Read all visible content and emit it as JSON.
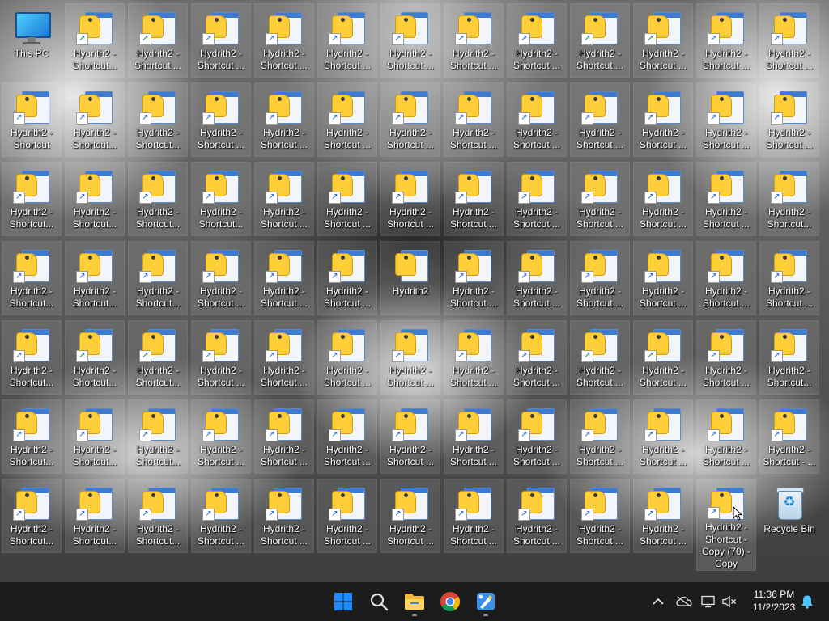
{
  "desktop": {
    "this_pc_label": "This PC",
    "recycle_bin_label": "Recycle Bin",
    "copy_label": "Hydrith2 - Shortcut - Copy (70) - Copy",
    "rows": [
      [
        "Hydrith2 - Shortcut...",
        "Hydrith2 - Shortcut ...",
        "Hydrith2 - Shortcut ...",
        "Hydrith2 - Shortcut ...",
        "Hydrith2 - Shortcut ...",
        "Hydrith2 - Shortcut ...",
        "Hydrith2 - Shortcut ...",
        "Hydrith2 - Shortcut ...",
        "Hydrith2 - Shortcut ...",
        "Hydrith2 - Shortcut ...",
        "Hydrith2 - Shortcut ...",
        "Hydrith2 - Shortcut ..."
      ],
      [
        "Hydrith2 - Shortcut",
        "Hydrith2 - Shortcut...",
        "Hydrith2 - Shortcut...",
        "Hydrith2 - Shortcut ...",
        "Hydrith2 - Shortcut ...",
        "Hydrith2 - Shortcut ...",
        "Hydrith2 - Shortcut ...",
        "Hydrith2 - Shortcut ...",
        "Hydrith2 - Shortcut ...",
        "Hydrith2 - Shortcut ...",
        "Hydrith2 - Shortcut ...",
        "Hydrith2 - Shortcut ...",
        "Hydrith2 - Shortcut ..."
      ],
      [
        "Hydrith2 - Shortcut...",
        "Hydrith2 - Shortcut...",
        "Hydrith2 - Shortcut...",
        "Hydrith2 - Shortcut...",
        "Hydrith2 - Shortcut ...",
        "Hydrith2 - Shortcut ...",
        "Hydrith2 - Shortcut ...",
        "Hydrith2 - Shortcut ...",
        "Hydrith2 - Shortcut ...",
        "Hydrith2 - Shortcut ...",
        "Hydrith2 - Shortcut ...",
        "Hydrith2 - Shortcut ...",
        "Hydrith2 - Shortcut..."
      ],
      [
        "Hydrith2 - Shortcut...",
        "Hydrith2 - Shortcut...",
        "Hydrith2 - Shortcut...",
        "Hydrith2 - Shortcut ...",
        "Hydrith2 - Shortcut ...",
        "Hydrith2 - Shortcut ...",
        "Hydrith2",
        "Hydrith2 - Shortcut ...",
        "Hydrith2 - Shortcut ...",
        "Hydrith2 - Shortcut ...",
        "Hydrith2 - Shortcut ...",
        "Hydrith2 - Shortcut ...",
        "Hydrith2 - Shortcut ..."
      ],
      [
        "Hydrith2 - Shortcut...",
        "Hydrith2 - Shortcut...",
        "Hydrith2 - Shortcut...",
        "Hydrith2 - Shortcut ...",
        "Hydrith2 - Shortcut ...",
        "Hydrith2 - Shortcut ...",
        "Hydrith2 - Shortcut ...",
        "Hydrith2 - Shortcut ...",
        "Hydrith2 - Shortcut ...",
        "Hydrith2 - Shortcut ...",
        "Hydrith2 - Shortcut ...",
        "Hydrith2 - Shortcut ...",
        "Hydrith2 - Shortcut..."
      ],
      [
        "Hydrith2 - Shortcut...",
        "Hydrith2 - Shortcut...",
        "Hydrith2 - Shortcut...",
        "Hydrith2 - Shortcut ...",
        "Hydrith2 - Shortcut ...",
        "Hydrith2 - Shortcut ...",
        "Hydrith2 - Shortcut ...",
        "Hydrith2 - Shortcut ...",
        "Hydrith2 - Shortcut ...",
        "Hydrith2 - Shortcut ...",
        "Hydrith2 - Shortcut ...",
        "Hydrith2 - Shortcut ...",
        "Hydrith2 - Shortcut - ..."
      ],
      [
        "Hydrith2 - Shortcut...",
        "Hydrith2 - Shortcut...",
        "Hydrith2 - Shortcut...",
        "Hydrith2 - Shortcut ...",
        "Hydrith2 - Shortcut ...",
        "Hydrith2 - Shortcut ...",
        "Hydrith2 - Shortcut ...",
        "Hydrith2 - Shortcut ...",
        "Hydrith2 - Shortcut ...",
        "Hydrith2 - Shortcut ...",
        "Hydrith2 - Shortcut ..."
      ]
    ]
  },
  "taskbar": {
    "apps": [
      {
        "name": "start-button",
        "icon": "windows-logo-icon"
      },
      {
        "name": "search-button",
        "icon": "search-icon"
      },
      {
        "name": "file-explorer-button",
        "icon": "folder-icon"
      },
      {
        "name": "chrome-button",
        "icon": "chrome-icon"
      },
      {
        "name": "paint-button",
        "icon": "paint-icon"
      }
    ],
    "time": "11:36 PM",
    "date": "11/2/2023"
  },
  "colors": {
    "taskbar_bg": "#1c1c1c",
    "windows_blue": "#1a8cff",
    "folder_yellow": "#ffcf3a",
    "notification_blue": "#4cc2ff"
  }
}
